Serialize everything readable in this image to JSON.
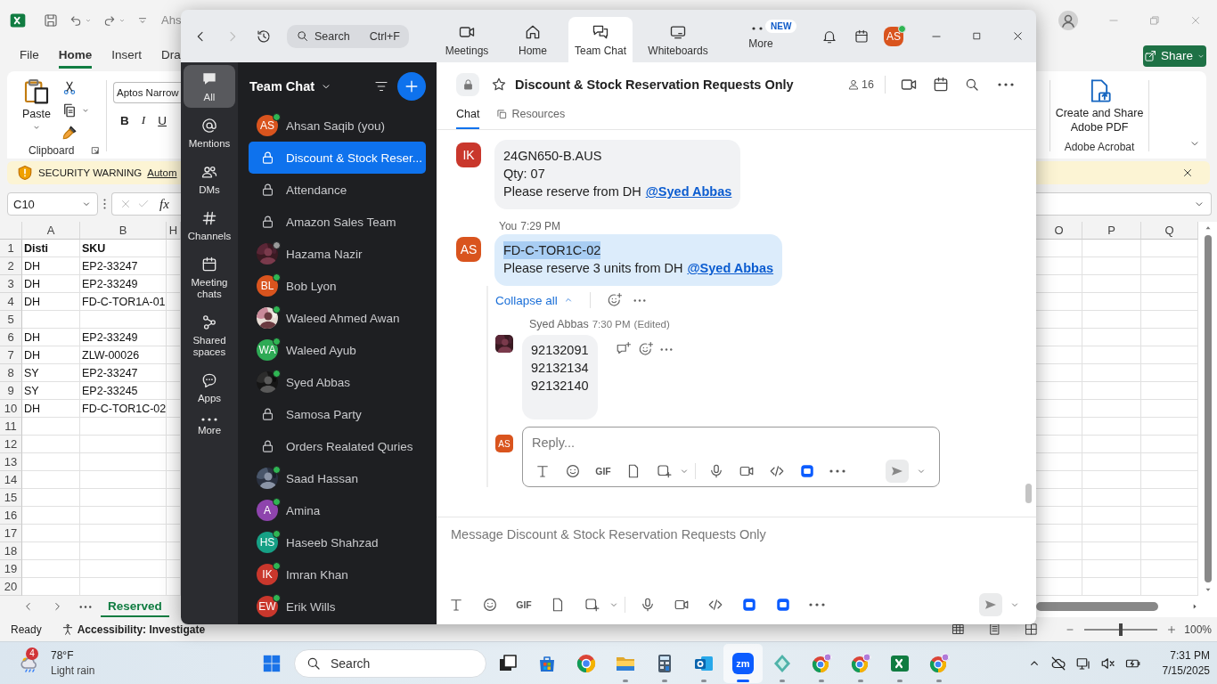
{
  "excel": {
    "title_fragment": "Ahs",
    "ribbon_tabs": [
      {
        "label": "File",
        "selected": false
      },
      {
        "label": "Home",
        "selected": true
      },
      {
        "label": "Insert",
        "selected": false
      },
      {
        "label": "Dra",
        "selected": false
      }
    ],
    "share_button": "Share",
    "clipboard": {
      "paste_label": "Paste",
      "group_label": "Clipboard"
    },
    "font": {
      "name": "Aptos Narrow",
      "styles": [
        "B",
        "I",
        "U"
      ]
    },
    "acrobat": {
      "button": "Create and Share Adobe PDF",
      "group_label": "Adobe Acrobat"
    },
    "security_bar": {
      "title": "SECURITY WARNING",
      "link": "Autom"
    },
    "name_box": "C10",
    "formula_label": "fx",
    "grid": {
      "left_columns": [
        "A",
        "B",
        "H"
      ],
      "right_columns": [
        "O",
        "P",
        "Q"
      ],
      "rows": [
        {
          "number": "1",
          "a": "Disti",
          "b": "SKU",
          "bold": true
        },
        {
          "number": "2",
          "a": "DH",
          "b": "EP2-33247",
          "bold": false
        },
        {
          "number": "3",
          "a": "DH",
          "b": "EP2-33249",
          "bold": false
        },
        {
          "number": "4",
          "a": "DH",
          "b": "FD-C-TOR1A-01",
          "bold": false
        },
        {
          "number": "5"
        },
        {
          "number": "6",
          "a": "DH",
          "b": "EP2-33249",
          "bold": false
        },
        {
          "number": "7",
          "a": "DH",
          "b": "ZLW-00026",
          "bold": false
        },
        {
          "number": "8",
          "a": "SY",
          "b": "EP2-33247",
          "bold": false
        },
        {
          "number": "9",
          "a": "SY",
          "b": "EP2-33245",
          "bold": false
        },
        {
          "number": "10",
          "a": "DH",
          "b": "FD-C-TOR1C-02",
          "bold": false
        },
        {
          "number": "11"
        },
        {
          "number": "12"
        },
        {
          "number": "13"
        },
        {
          "number": "14"
        },
        {
          "number": "15"
        },
        {
          "number": "16"
        },
        {
          "number": "17"
        },
        {
          "number": "18"
        },
        {
          "number": "19"
        },
        {
          "number": "20"
        }
      ]
    },
    "sheet_tabs": [
      {
        "label": "Reserved",
        "selected": true
      }
    ],
    "status_bar": {
      "ready": "Ready",
      "accessibility": "Accessibility: Investigate",
      "zoom": "100%",
      "zoom_slider": {
        "level": 0.5
      }
    }
  },
  "zoom": {
    "nav": {
      "search_placeholder": "Search",
      "search_shortcut": "Ctrl+F",
      "tabs": [
        {
          "kind": "meetings",
          "label": "Meetings",
          "selected": false
        },
        {
          "kind": "home",
          "label": "Home",
          "selected": false
        },
        {
          "kind": "team-chat",
          "label": "Team Chat",
          "selected": true
        },
        {
          "kind": "whiteboards",
          "label": "Whiteboards",
          "selected": false
        },
        {
          "kind": "more",
          "label": "More",
          "selected": false,
          "badge": "NEW"
        }
      ],
      "avatar": {
        "initials": "AS",
        "color": "#d9541e",
        "presence": {
          "color": "#2fb553"
        }
      }
    },
    "rail": [
      {
        "kind": "all",
        "label": "All",
        "selected": true
      },
      {
        "kind": "mentions",
        "label": "Mentions",
        "selected": false
      },
      {
        "kind": "dms",
        "label": "DMs",
        "selected": false
      },
      {
        "kind": "channels",
        "label": "Channels",
        "selected": false
      },
      {
        "kind": "meeting-chats",
        "label": "Meeting chats",
        "selected": false
      },
      {
        "kind": "shared-spaces",
        "label": "Shared spaces",
        "selected": false
      },
      {
        "kind": "apps",
        "label": "Apps",
        "selected": false
      },
      {
        "kind": "more",
        "label": "More",
        "selected": false
      }
    ],
    "chat_list": {
      "title": "Team Chat",
      "items": [
        {
          "kind": "initials",
          "name": "Ahsan Saqib (you)",
          "initials": "AS",
          "color": "#d9541e",
          "presence": {
            "color": "#2fb553"
          },
          "selected": false
        },
        {
          "kind": "channel",
          "name": "Discount & Stock Reser...",
          "selected": true
        },
        {
          "kind": "channel",
          "name": "Attendance",
          "selected": false
        },
        {
          "kind": "channel",
          "name": "Amazon Sales Team",
          "selected": false
        },
        {
          "kind": "picture",
          "name": "Hazama Nazir",
          "presence": {
            "color": "#9a9a9a"
          },
          "selected": false
        },
        {
          "kind": "initials",
          "name": "Bob Lyon",
          "initials": "BL",
          "color": "#d9541e",
          "presence": {
            "color": "#2fb553"
          },
          "selected": false
        },
        {
          "kind": "picture",
          "name": "Waleed Ahmed Awan",
          "presence": {
            "color": "#2fb553"
          },
          "selected": false
        },
        {
          "kind": "initials",
          "name": "Waleed Ayub",
          "initials": "WA",
          "color": "#2eaa55",
          "presence": {
            "color": "#2fb553"
          },
          "selected": false
        },
        {
          "kind": "picture",
          "name": "Syed Abbas",
          "presence": {
            "color": "#2fb553"
          },
          "selected": false
        },
        {
          "kind": "channel",
          "name": "Samosa Party",
          "selected": false
        },
        {
          "kind": "channel",
          "name": "Orders Realated Quries",
          "selected": false
        },
        {
          "kind": "picture",
          "name": "Saad Hassan",
          "presence": {
            "color": "#2fb553"
          },
          "selected": false
        },
        {
          "kind": "initials",
          "name": "Amina",
          "initials": "A",
          "color": "#8e44ad",
          "presence": {
            "color": "#2fb553"
          },
          "selected": false
        },
        {
          "kind": "initials",
          "name": "Haseeb Shahzad",
          "initials": "HS",
          "color": "#16a085",
          "presence": {
            "color": "#2fb553"
          },
          "selected": false
        },
        {
          "kind": "initials",
          "name": "Imran Khan",
          "initials": "IK",
          "color": "#c9372c",
          "presence": {
            "color": "#2fb553"
          },
          "selected": false
        },
        {
          "kind": "initials",
          "name": "Erik Wills",
          "initials": "EW",
          "color": "#c9372c",
          "presence": {
            "color": "#2fb553"
          },
          "selected": false
        }
      ]
    },
    "channel": {
      "title": "Discount & Stock Reservation Requests Only",
      "members": "16",
      "tabs": [
        {
          "kind": "chat",
          "label": "Chat",
          "selected": true
        },
        {
          "kind": "resources",
          "label": "Resources",
          "selected": false
        }
      ],
      "messages": [
        {
          "own": false,
          "avatar": {
            "kind": "initials",
            "initials": "IK",
            "color": "#c9372c"
          },
          "lines": [
            {
              "text": "24GN650-B.AUS",
              "highlighted": false
            },
            {
              "text": "Qty: 07",
              "highlighted": false
            },
            {
              "text": "Please reserve from DH",
              "mention": "@Syed Abbas",
              "highlighted": false
            }
          ]
        },
        {
          "own": true,
          "sender": "You",
          "time": "7:29 PM",
          "avatar": {
            "kind": "initials",
            "initials": "AS",
            "color": "#d9541e"
          },
          "lines": [
            {
              "text": "FD-C-TOR1C-02",
              "highlighted": true
            },
            {
              "text": "Please reserve 3 units from DH",
              "mention": "@Syed Abbas",
              "highlighted": false
            }
          ],
          "thread": {
            "collapse_label": "Collapse all",
            "replies": [
              {
                "sender": "Syed Abbas",
                "time": "7:30 PM",
                "edited": "(Edited)",
                "avatar": {
                  "kind": "picture"
                },
                "lines": [
                  {
                    "text": "92132091",
                    "highlighted": false
                  },
                  {
                    "text": "92132134",
                    "highlighted": false
                  },
                  {
                    "text": "92132140",
                    "highlighted": false
                  }
                ]
              }
            ],
            "reply_box": {
              "avatar": {
                "kind": "initials",
                "initials": "AS",
                "color": "#d9541e"
              },
              "placeholder": "Reply...",
              "tools": [
                {
                  "kind": "text"
                },
                {
                  "kind": "emoji"
                },
                {
                  "kind": "gif",
                  "label": "GIF"
                },
                {
                  "kind": "file"
                },
                {
                  "kind": "screenshot"
                },
                {
                  "kind": "caret"
                },
                {
                  "kind": "divider"
                },
                {
                  "kind": "mic"
                },
                {
                  "kind": "video"
                },
                {
                  "kind": "code"
                },
                {
                  "kind": "app"
                },
                {
                  "kind": "more"
                }
              ]
            }
          }
        }
      ],
      "composer": {
        "placeholder": "Message Discount & Stock Reservation Requests Only",
        "tools": [
          {
            "kind": "text"
          },
          {
            "kind": "emoji"
          },
          {
            "kind": "gif",
            "label": "GIF"
          },
          {
            "kind": "file"
          },
          {
            "kind": "screenshot"
          },
          {
            "kind": "caret"
          },
          {
            "kind": "divider"
          },
          {
            "kind": "mic"
          },
          {
            "kind": "video"
          },
          {
            "kind": "code"
          },
          {
            "kind": "app"
          },
          {
            "kind": "app"
          },
          {
            "kind": "more"
          }
        ]
      }
    }
  },
  "taskbar": {
    "weather": {
      "badge": "4",
      "temperature": "78°F",
      "condition": "Light rain"
    },
    "search": "Search",
    "apps": [
      {
        "kind": "task-view",
        "running": false,
        "selected": false
      },
      {
        "kind": "store",
        "running": false,
        "selected": false
      },
      {
        "kind": "browser",
        "running": false,
        "selected": false
      },
      {
        "kind": "folder",
        "running": true,
        "selected": false
      },
      {
        "kind": "calculator",
        "running": true,
        "selected": false
      },
      {
        "kind": "mail",
        "running": true,
        "selected": false
      },
      {
        "kind": "meeting",
        "label": "zm",
        "running": true,
        "selected": true
      },
      {
        "kind": "diamond",
        "running": true,
        "selected": false
      },
      {
        "kind": "browser-profile",
        "running": true,
        "selected": false
      },
      {
        "kind": "browser-profile",
        "running": true,
        "selected": false
      },
      {
        "kind": "sheet",
        "running": true,
        "selected": false
      },
      {
        "kind": "browser-profile",
        "running": true,
        "selected": false
      }
    ],
    "time": "7:31 PM",
    "date": "7/15/2025"
  }
}
